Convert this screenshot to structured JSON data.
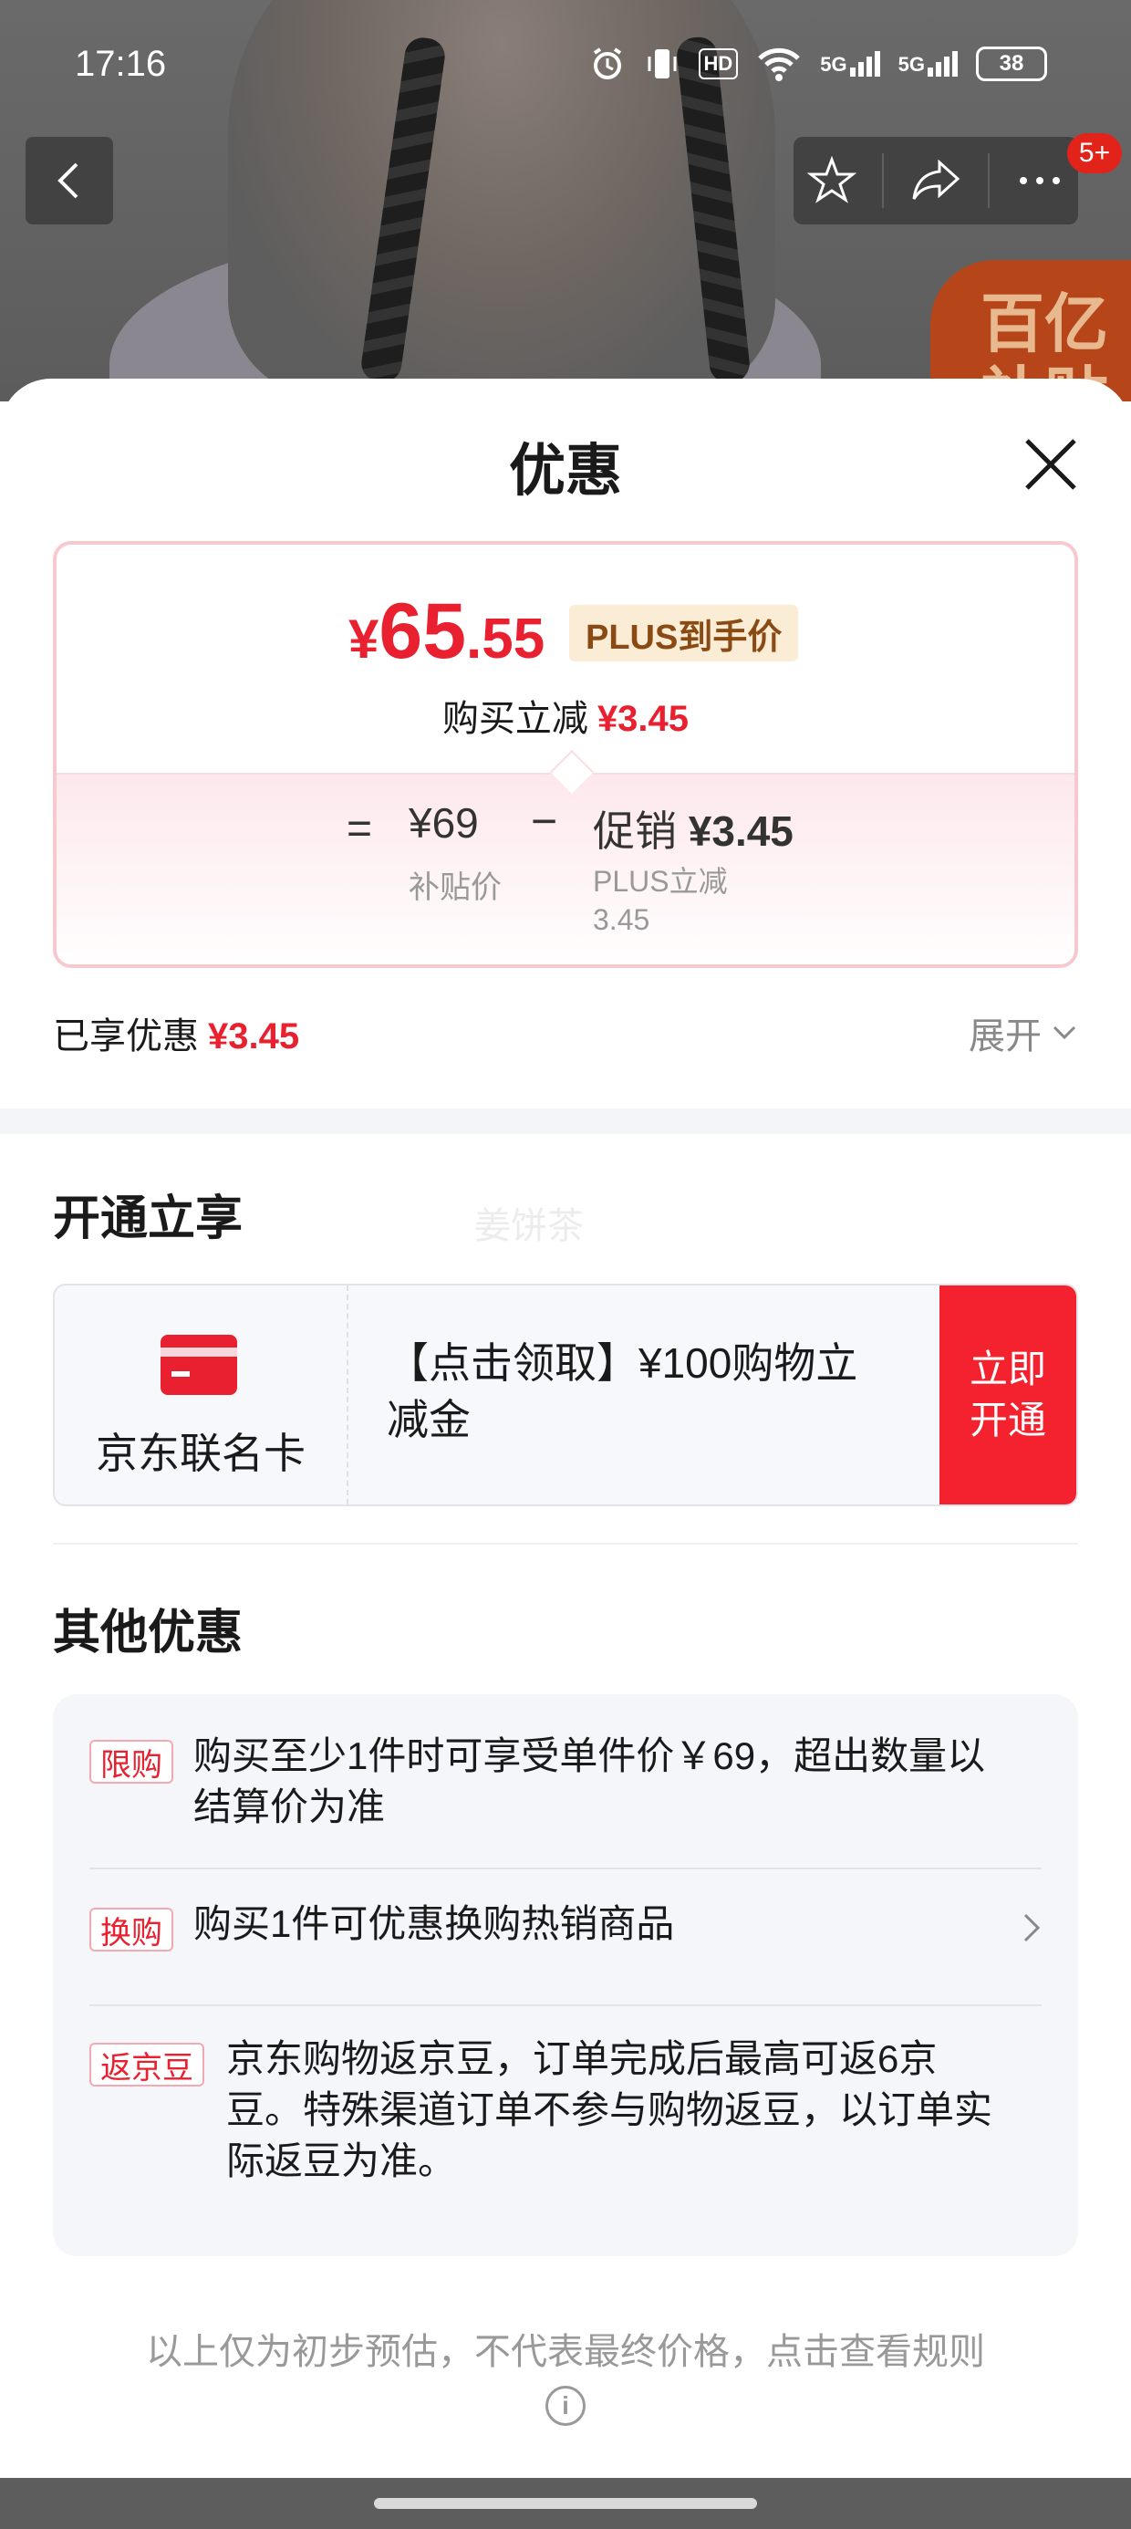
{
  "status_bar": {
    "time": "17:16",
    "hd_label": "HD",
    "net1": "5G",
    "net2": "5G",
    "battery": "38"
  },
  "top_nav": {
    "badge_count": "5+"
  },
  "background": {
    "badge_text": "百亿补贴"
  },
  "sheet": {
    "title": "优惠",
    "price_card": {
      "price_symbol": "¥",
      "price_int": "65",
      "price_dec": ".55",
      "plus_tag": "PLUS到手价",
      "reduce_label": "购买立减",
      "reduce_amount": "¥3.45",
      "equals": "=",
      "subsidy_price": "¥69",
      "subsidy_label": "补贴价",
      "minus": "−",
      "promo_label": "促销",
      "promo_amount": "¥3.45",
      "promo_detail": "PLUS立减 3.45"
    },
    "enjoyed": {
      "label": "已享优惠",
      "amount": "¥3.45",
      "expand_label": "展开"
    },
    "open_section": {
      "title": "开通立享",
      "watermark": "姜饼茶",
      "card_name": "京东联名卡",
      "card_desc": "【点击领取】¥100购物立减金",
      "button": "立即开通"
    },
    "other_section": {
      "title": "其他优惠",
      "items": [
        {
          "tag": "限购",
          "text": "购买至少1件时可享受单件价￥69，超出数量以结算价为准"
        },
        {
          "tag": "换购",
          "text": "购买1件可优惠换购热销商品"
        },
        {
          "tag": "返京豆",
          "text": "京东购物返京豆，订单完成后最高可返6京豆。特殊渠道订单不参与购物返豆，以订单实际返豆为准。"
        }
      ]
    },
    "footer_note": "以上仅为初步预估，不代表最终价格，点击查看规则"
  },
  "colors": {
    "accent_red": "#e8202f",
    "button_red": "#f4222f",
    "plus_tag_bg": "#fbecd6"
  },
  "icons": [
    "back-icon",
    "star-icon",
    "share-icon",
    "more-icon",
    "close-icon",
    "chevron-down-icon",
    "card-icon",
    "chevron-right-icon",
    "info-icon"
  ]
}
